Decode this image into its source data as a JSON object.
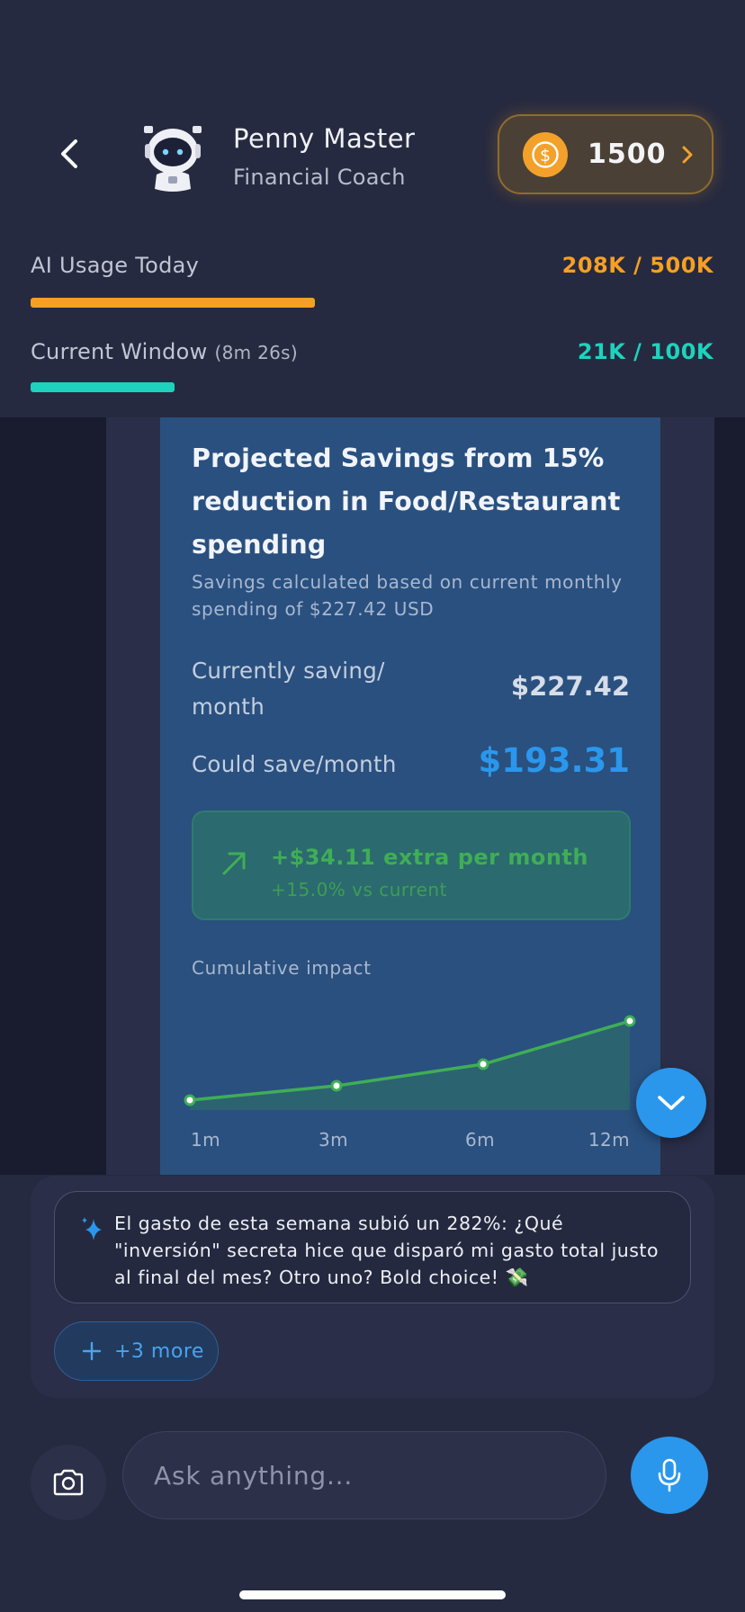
{
  "header": {
    "coach_name": "Penny Master",
    "coach_role": "Financial Coach",
    "coins": "1500"
  },
  "usage": {
    "today": {
      "label": "AI Usage Today",
      "value": "208K / 500K",
      "fraction": 0.416,
      "color": "#f5a024"
    },
    "window": {
      "label": "Current Window",
      "timer": "(8m 26s)",
      "value": "21K / 100K",
      "fraction": 0.21,
      "color": "#1ed3bd"
    }
  },
  "card": {
    "title": "Projected Savings from 15% reduction in Food/Restaurant spending",
    "subtitle": "Savings calculated based on current monthly spending of $227.42 USD",
    "current_label": "Currently saving/ month",
    "current_value": "$227.42",
    "could_label": "Could save/month",
    "could_value": "$193.31",
    "extra_main": "+$34.11 extra per month",
    "extra_sub": "+15.0% vs current",
    "accent": "#2a97ec",
    "positive": "#3fae57"
  },
  "chart_data": {
    "type": "area",
    "title": "Cumulative impact",
    "categories": [
      "1m",
      "3m",
      "6m",
      "12m"
    ],
    "series": [
      {
        "values": [
          34.11,
          102.33,
          204.66,
          409.32
        ]
      }
    ]
  },
  "suggestions": {
    "text": "El gasto de esta semana subió un 282%: ¿Qué \"inversión\" secreta hice que disparó mi gasto total justo al final del mes? Otro uno? Bold choice! 💸",
    "more_label": "+3 more"
  },
  "input": {
    "placeholder": "Ask anything..."
  }
}
